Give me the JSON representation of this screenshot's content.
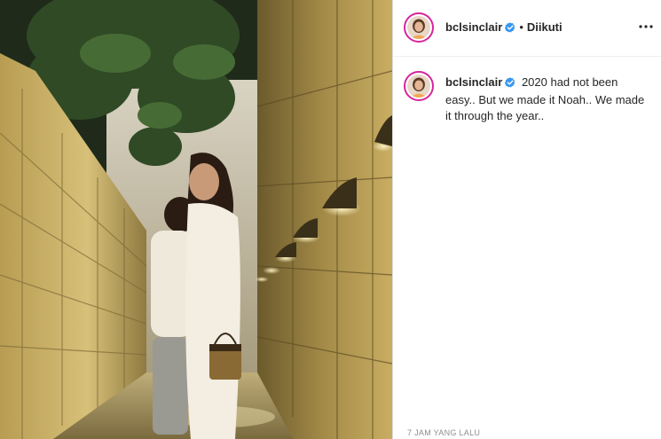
{
  "post": {
    "username": "bclsinclair",
    "follow_state": "Diikuti",
    "caption": "2020 had not been easy.. But we made it Noah.. We made it through the year..",
    "timestamp": "7 JAM YANG LALU"
  },
  "icons": {
    "verified": "verified-badge-icon",
    "more": "more-options-icon"
  },
  "colors": {
    "verified_blue": "#3897f0",
    "story_ring": "#d6249f",
    "muted_text": "#8e8e8e"
  }
}
